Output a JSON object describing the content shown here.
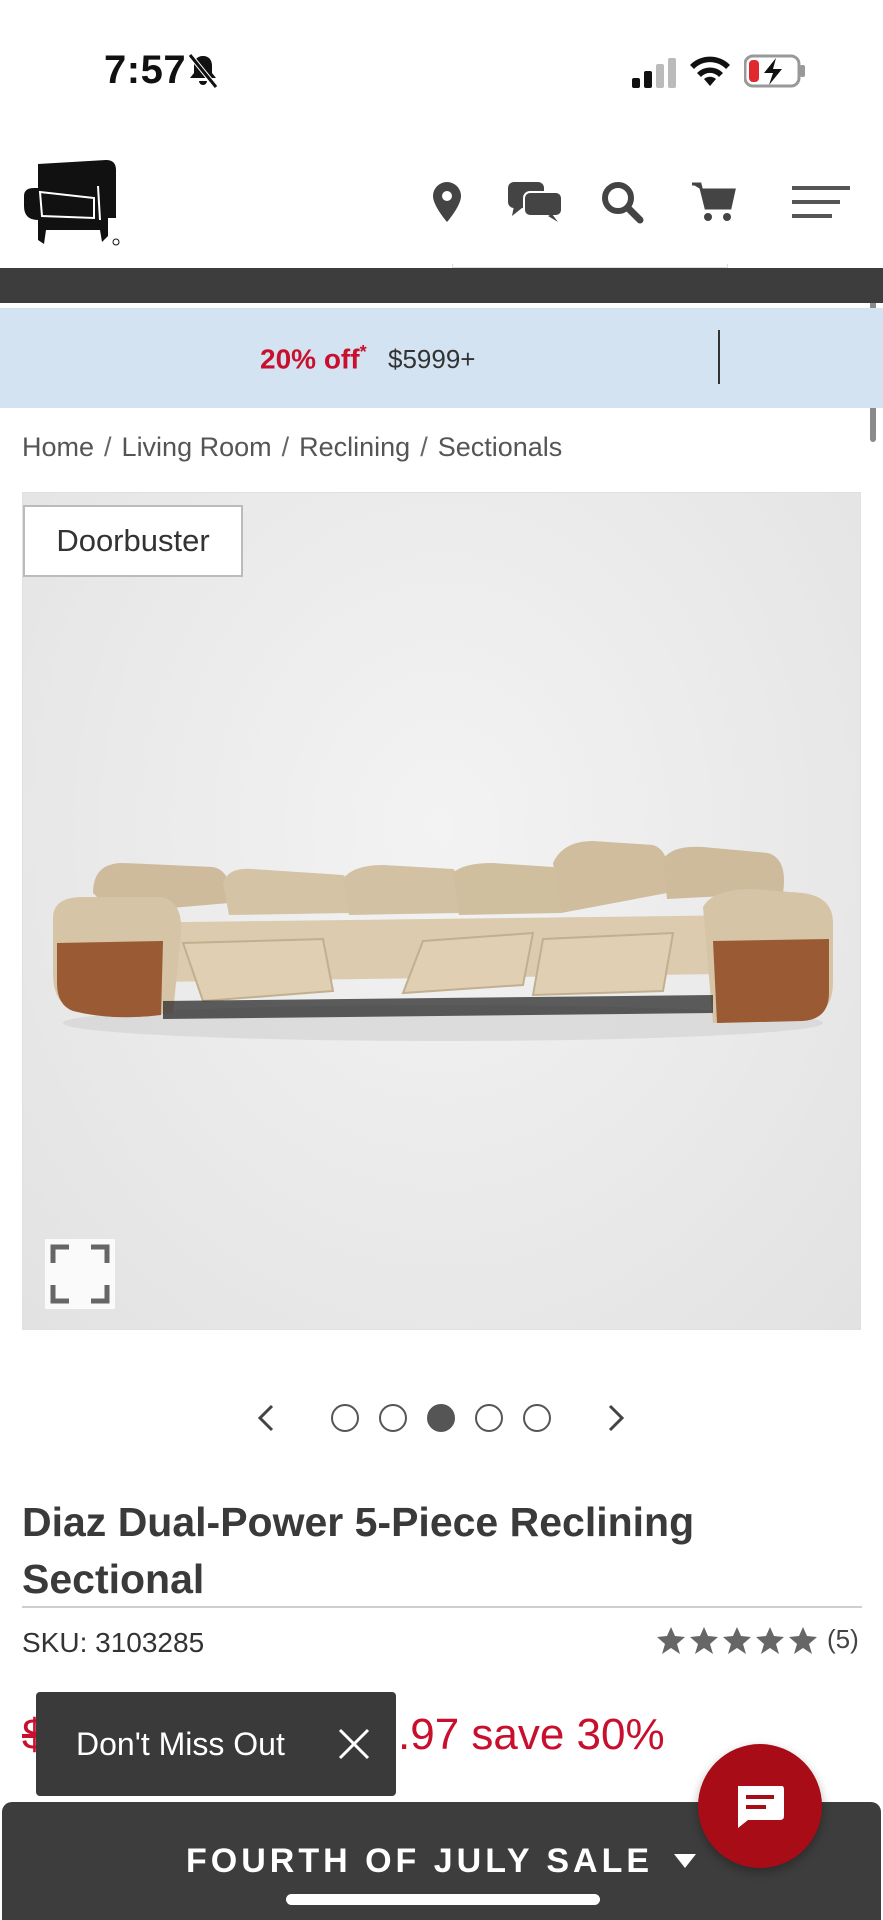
{
  "status_bar": {
    "time": "7:57"
  },
  "promo": {
    "discount": "20% off",
    "asterisk": "*",
    "amount": "$5999+"
  },
  "breadcrumb": [
    "Home",
    "Living Room",
    "Reclining",
    "Sectionals"
  ],
  "breadcrumb_separator": "/",
  "product": {
    "badge": "Doorbuster",
    "title": "Diaz Dual-Power 5-Piece Reclining Sectional",
    "sku_label": "SKU: 3103285",
    "rating": 5,
    "review_count": "(5)",
    "price_old_fragment": "$",
    "price_new_fragment": ".97 save 30%"
  },
  "carousel": {
    "total": 5,
    "active_index": 2
  },
  "toast": {
    "text": "Don't Miss Out"
  },
  "sale_bar": {
    "label": "FOURTH OF JULY SALE"
  },
  "colors": {
    "accent_red": "#c8102e",
    "fab_red": "#a80c16",
    "dark_bar": "#3d3d3d",
    "promo_bg": "#d3e3f1"
  }
}
